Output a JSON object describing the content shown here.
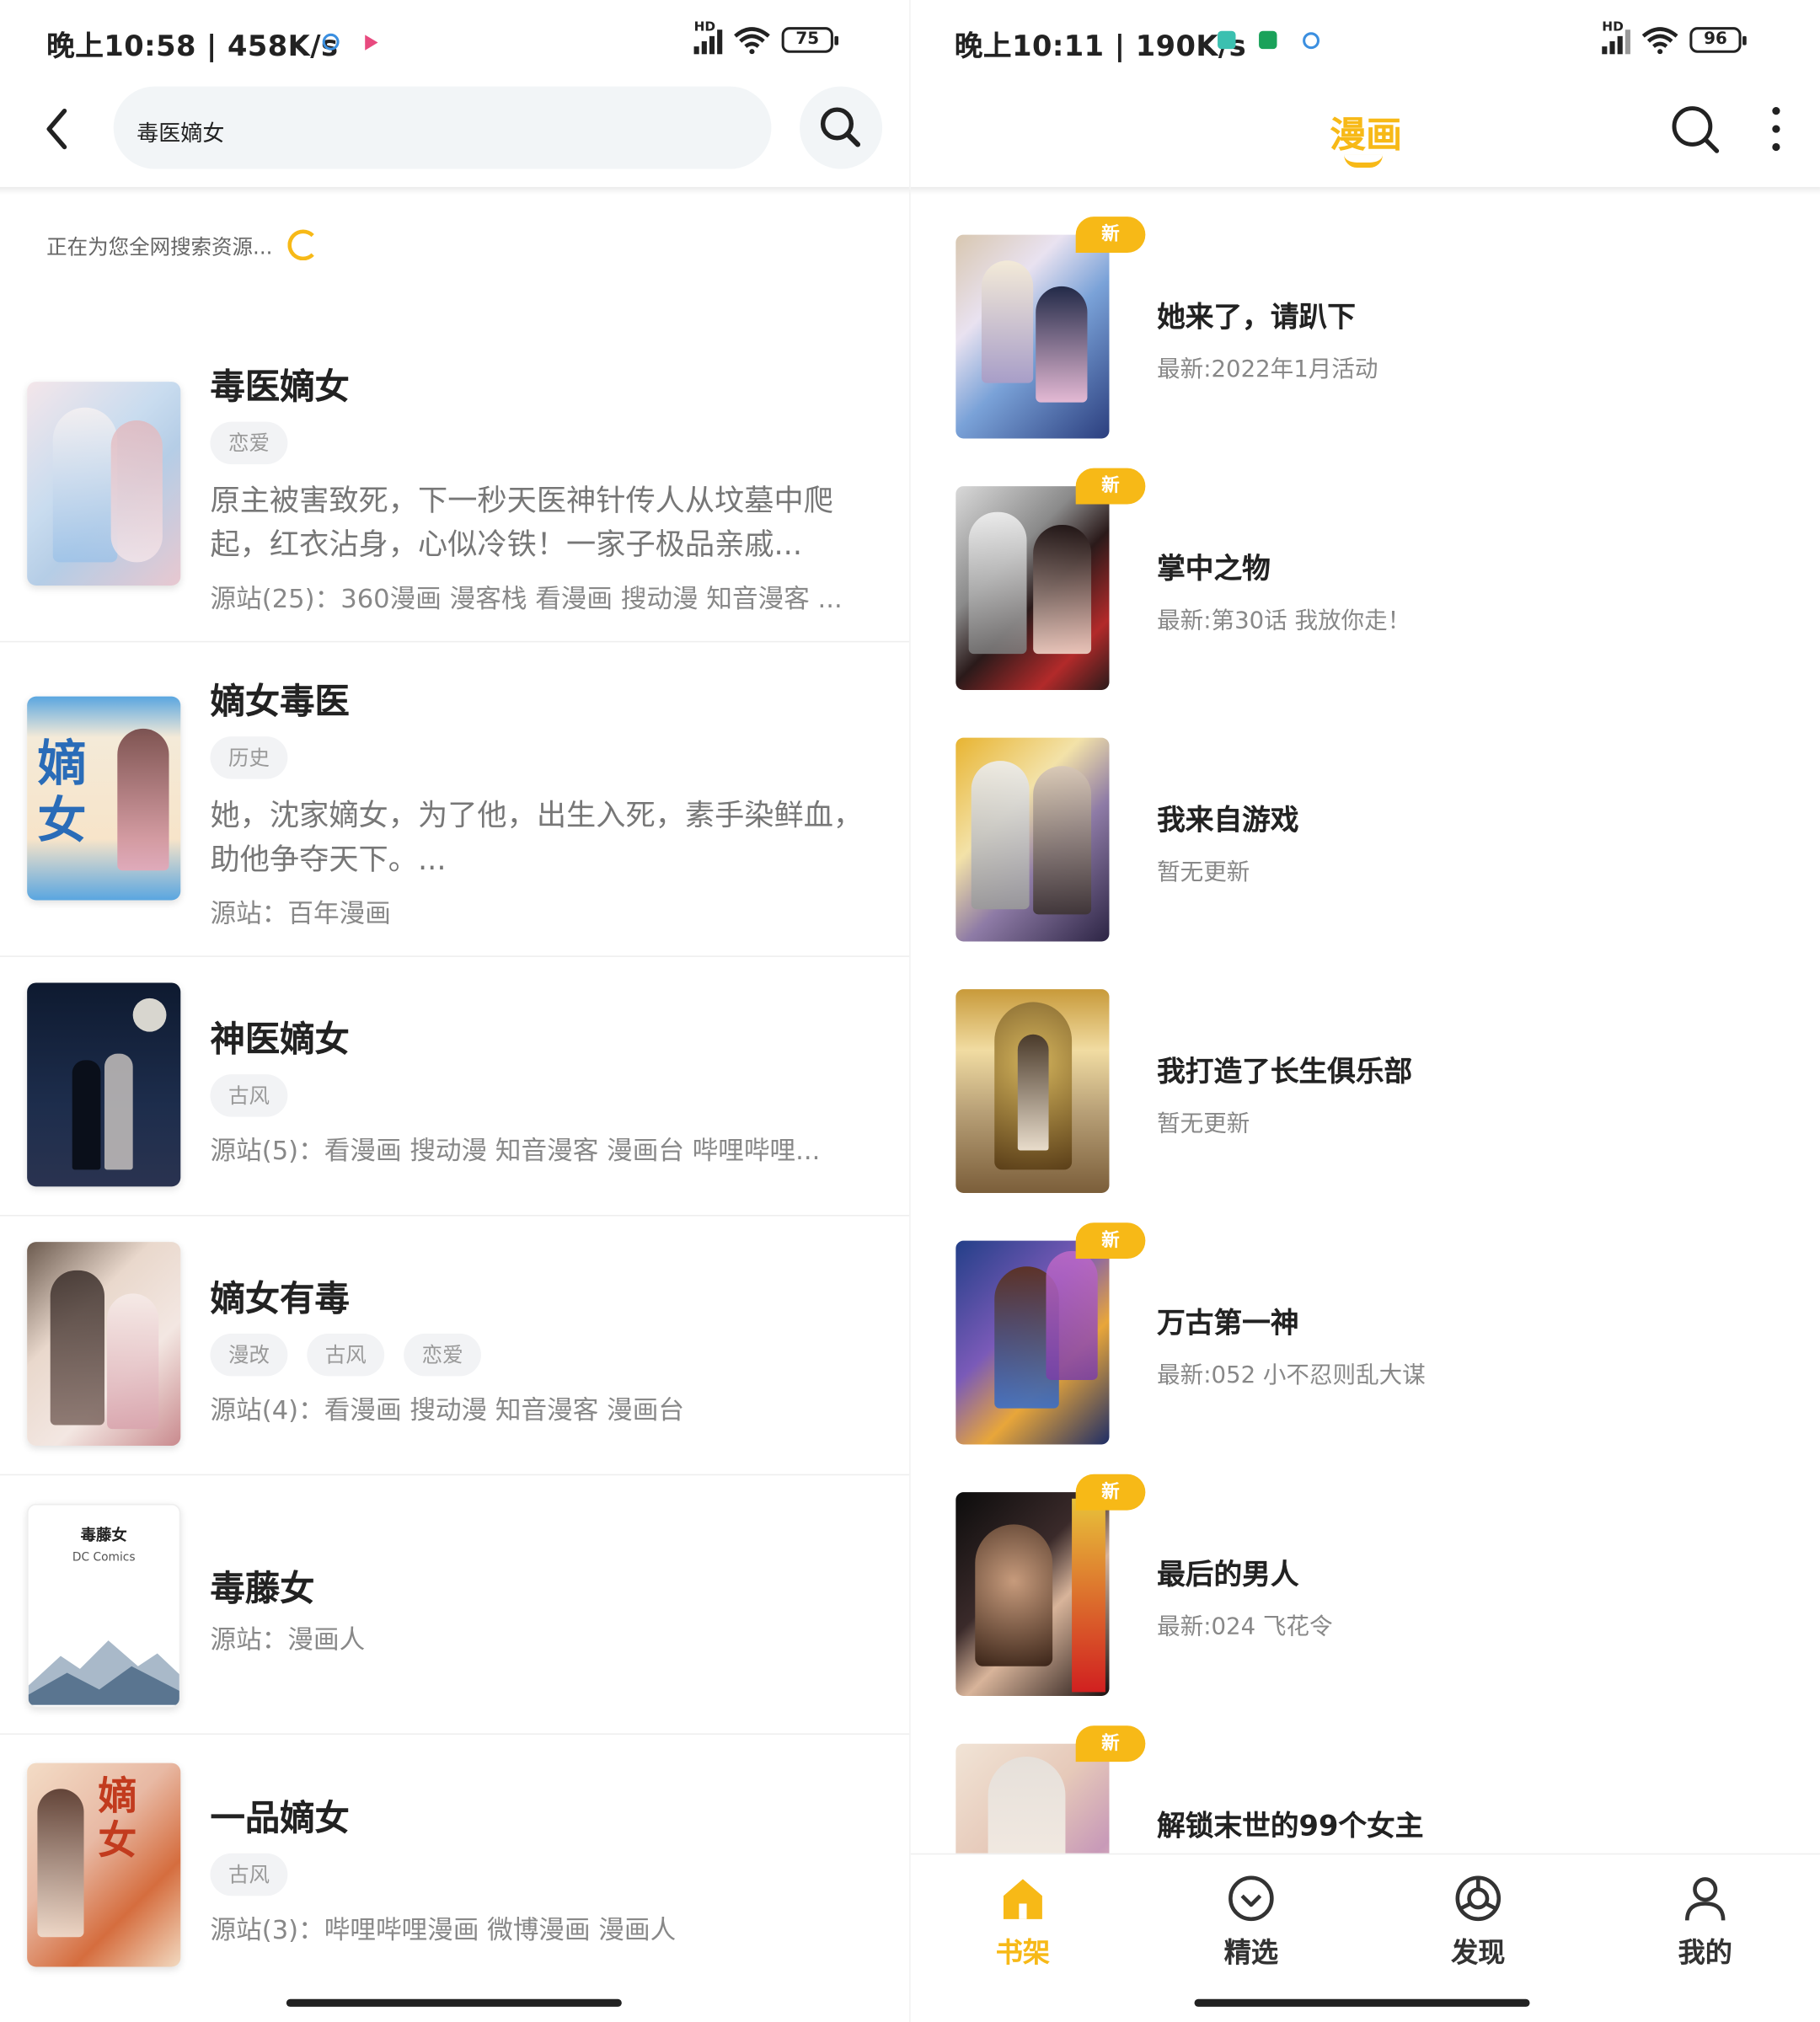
{
  "left": {
    "status": {
      "time": "晚上10:58 | 458K/s",
      "battery": "75",
      "signal_label": "HD"
    },
    "search": {
      "query": "毒医嫡女"
    },
    "searching_text": "正在为您全网搜索资源...",
    "results": [
      {
        "title": "毒医嫡女",
        "tags": [
          "恋爱"
        ],
        "desc": "原主被害致死，下一秒天医神针传人从坟墓中爬起，红衣沾身，心似冷铁！一家子极品亲戚...",
        "sources": "源站(25)：360漫画 漫客栈 看漫画 搜动漫 知音漫客 ..."
      },
      {
        "title": "嫡女毒医",
        "tags": [
          "历史"
        ],
        "desc": "她，沈家嫡女，为了他，出生入死，素手染鲜血，助他争夺天下。...",
        "sources": "源站：百年漫画"
      },
      {
        "title": "神医嫡女",
        "tags": [
          "古风"
        ],
        "desc": "",
        "sources": "源站(5)：看漫画 搜动漫 知音漫客 漫画台 哔哩哔哩..."
      },
      {
        "title": "嫡女有毒",
        "tags": [
          "漫改",
          "古风",
          "恋爱"
        ],
        "desc": "",
        "sources": "源站(4)：看漫画 搜动漫 知音漫客 漫画台"
      },
      {
        "title": "毒藤女",
        "tags": [],
        "desc": "",
        "sources": "源站：漫画人",
        "cover_title": "毒藤女",
        "cover_sub": "DC Comics"
      },
      {
        "title": "一品嫡女",
        "tags": [
          "古风"
        ],
        "desc": "",
        "sources": "源站(3)：哔哩哔哩漫画 微博漫画 漫画人"
      }
    ]
  },
  "right": {
    "status": {
      "time": "晚上10:11 | 190K/s",
      "battery": "96",
      "signal_label": "HD"
    },
    "title": "漫画",
    "new_badge": "新",
    "shelf": [
      {
        "title": "她来了，请趴下",
        "update": "最新:2022年1月活动",
        "is_new": true
      },
      {
        "title": "掌中之物",
        "update": "最新:第30话 我放你走！",
        "is_new": true
      },
      {
        "title": "我来自游戏",
        "update": "暂无更新",
        "is_new": false
      },
      {
        "title": "我打造了长生俱乐部",
        "update": "暂无更新",
        "is_new": false
      },
      {
        "title": "万古第一神",
        "update": "最新:052 小不忍则乱大谋",
        "is_new": true
      },
      {
        "title": "最后的男人",
        "update": "最新:024 飞花令",
        "is_new": true
      },
      {
        "title": "解锁末世的99个女主",
        "update": "",
        "is_new": true
      }
    ],
    "tabs": [
      {
        "label": "书架",
        "icon": "home-icon",
        "active": true
      },
      {
        "label": "精选",
        "icon": "featured-icon",
        "active": false
      },
      {
        "label": "发现",
        "icon": "discover-icon",
        "active": false
      },
      {
        "label": "我的",
        "icon": "profile-icon",
        "active": false
      }
    ]
  },
  "colors": {
    "accent": "#f7b917",
    "text": "#222222",
    "muted": "#888888"
  }
}
